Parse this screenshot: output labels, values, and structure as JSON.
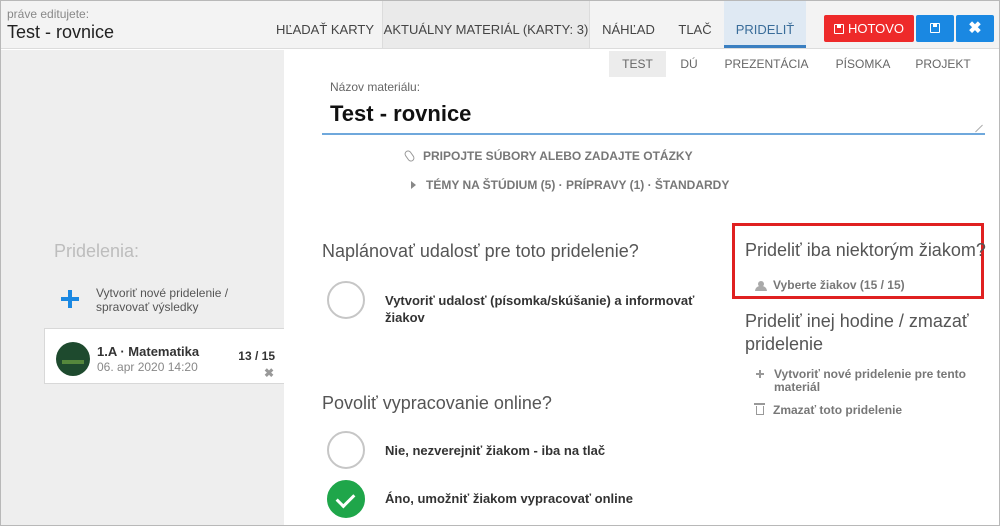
{
  "header": {
    "editing_label": "práve editujete:",
    "title": "Test - rovnice",
    "tabs": [
      {
        "label": "HĽADAŤ KARTY"
      },
      {
        "label": "AKTUÁLNY MATERIÁL (KARTY: 3)"
      },
      {
        "label": "NÁHĽAD"
      },
      {
        "label": "TLAČ"
      },
      {
        "label": "PRIDELIŤ",
        "active": true
      }
    ],
    "done_label": "HOTOVO",
    "close_symbol": "✖",
    "colors": {
      "done": "#ee2a2a",
      "save": "#1a88e2",
      "close": "#1a88e2"
    }
  },
  "sidebar": {
    "heading": "Pridelenia:",
    "new_assignment": "Vytvoriť nové pridelenie / spravovať výsledky",
    "class_card": {
      "name": "1.A · Matematika",
      "date": "06. apr 2020 14:20",
      "count": "13 / 15",
      "remove_symbol": "✖"
    }
  },
  "main": {
    "sub_tabs": [
      {
        "label": "TEST",
        "active": true
      },
      {
        "label": "DÚ"
      },
      {
        "label": "PREZENTÁCIA"
      },
      {
        "label": "PÍSOMKA"
      },
      {
        "label": "PROJEKT"
      }
    ],
    "material_label": "Názov materiálu:",
    "material_name": "Test - rovnice",
    "attach_label": "PRIPOJTE SÚBORY ALEBO ZADAJTE OTÁZKY",
    "topics_label": "TÉMY NA ŠTÚDIUM (5) · PRÍPRAVY (1) · ŠTANDARDY",
    "plan_heading": "Naplánovať udalosť pre toto pridelenie?",
    "plan_option": "Vytvoriť udalosť (písomka/skúšanie) a informovať žiakov",
    "online_heading": "Povoliť vypracovanie online?",
    "online_options": [
      {
        "label": "Nie, nezverejniť žiakom - iba na tlač",
        "checked": false
      },
      {
        "label": "Áno, umožniť žiakom vypracovať online",
        "checked": true
      }
    ]
  },
  "right_panel": {
    "partial_heading": "Prideliť iba niektorým žiakom?",
    "select_students": "Vyberte žiakov (15 / 15)",
    "other_heading": "Prideliť inej hodine / zmazať pridelenie",
    "new_for_material": "Vytvoriť nové pridelenie pre tento materiál",
    "delete_assignment": "Zmazať toto pridelenie",
    "highlight_color": "#e02020"
  }
}
